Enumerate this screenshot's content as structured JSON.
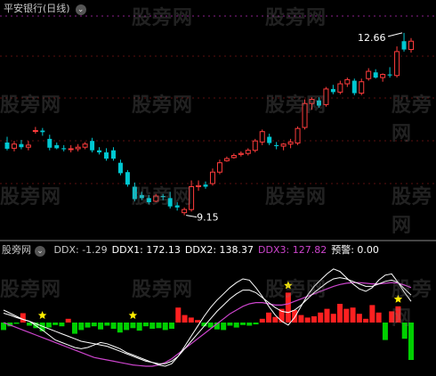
{
  "chart_title": "平安银行(日线)",
  "indicator_name": "股旁网",
  "watermark": "股旁网",
  "colors": {
    "up": "#ff3c3c",
    "down": "#00c8d2",
    "ddx_pos": "#ff2020",
    "ddx_neg": "#00d000",
    "ddx1": "#ffffff",
    "ddx2": "#ffffff",
    "ddx3": "#cc44cc",
    "star": "#ffee00",
    "grid": "#5a1010",
    "separator": "#888888",
    "title": "#c8c8c8",
    "label_value": "#ffffff"
  },
  "indicator_readout": [
    {
      "label": "DDX: ",
      "value": "-1.29",
      "color": "#c8c8c8"
    },
    {
      "label": "DDX1: ",
      "value": "172.13",
      "color": "#ffffff"
    },
    {
      "label": "DDX2: ",
      "value": "138.37",
      "color": "#ffffff"
    },
    {
      "label": "DDX3: ",
      "value": "127.82",
      "color": "#cc44cc"
    },
    {
      "label": "预警: ",
      "value": "0.00",
      "color": "#ffffff"
    }
  ],
  "chart_data": {
    "type": "candlestick",
    "price_high_label": "12.66",
    "price_low_label": "9.15",
    "price_range": [
      8.8,
      12.95
    ],
    "candles": [
      {
        "o": 10.55,
        "h": 10.66,
        "l": 10.4,
        "c": 10.43
      },
      {
        "o": 10.44,
        "h": 10.58,
        "l": 10.38,
        "c": 10.52
      },
      {
        "o": 10.52,
        "h": 10.6,
        "l": 10.42,
        "c": 10.46
      },
      {
        "o": 10.46,
        "h": 10.58,
        "l": 10.4,
        "c": 10.5
      },
      {
        "o": 10.78,
        "h": 10.85,
        "l": 10.72,
        "c": 10.78
      },
      {
        "o": 10.78,
        "h": 10.83,
        "l": 10.68,
        "c": 10.75
      },
      {
        "o": 10.62,
        "h": 10.7,
        "l": 10.4,
        "c": 10.45
      },
      {
        "o": 10.5,
        "h": 10.55,
        "l": 10.42,
        "c": 10.44
      },
      {
        "o": 10.44,
        "h": 10.5,
        "l": 10.38,
        "c": 10.42
      },
      {
        "o": 10.42,
        "h": 10.5,
        "l": 10.36,
        "c": 10.43
      },
      {
        "o": 10.43,
        "h": 10.52,
        "l": 10.38,
        "c": 10.46
      },
      {
        "o": 10.46,
        "h": 10.56,
        "l": 10.42,
        "c": 10.52
      },
      {
        "o": 10.58,
        "h": 10.64,
        "l": 10.36,
        "c": 10.4
      },
      {
        "o": 10.4,
        "h": 10.46,
        "l": 10.32,
        "c": 10.36
      },
      {
        "o": 10.36,
        "h": 10.44,
        "l": 10.2,
        "c": 10.24
      },
      {
        "o": 10.4,
        "h": 10.46,
        "l": 10.2,
        "c": 10.24
      },
      {
        "o": 10.16,
        "h": 10.22,
        "l": 9.92,
        "c": 9.96
      },
      {
        "o": 9.98,
        "h": 10.02,
        "l": 9.7,
        "c": 9.74
      },
      {
        "o": 9.7,
        "h": 9.78,
        "l": 9.42,
        "c": 9.46
      },
      {
        "o": 9.54,
        "h": 9.6,
        "l": 9.44,
        "c": 9.48
      },
      {
        "o": 9.48,
        "h": 9.54,
        "l": 9.36,
        "c": 9.4
      },
      {
        "o": 9.42,
        "h": 9.56,
        "l": 9.4,
        "c": 9.52
      },
      {
        "o": 9.52,
        "h": 9.56,
        "l": 9.44,
        "c": 9.5
      },
      {
        "o": 9.48,
        "h": 9.6,
        "l": 9.28,
        "c": 9.32
      },
      {
        "o": 9.34,
        "h": 9.4,
        "l": 9.24,
        "c": 9.3
      },
      {
        "o": 9.2,
        "h": 9.3,
        "l": 9.15,
        "c": 9.26
      },
      {
        "o": 9.26,
        "h": 9.82,
        "l": 9.22,
        "c": 9.7
      },
      {
        "o": 9.7,
        "h": 9.82,
        "l": 9.62,
        "c": 9.72
      },
      {
        "o": 9.74,
        "h": 9.8,
        "l": 9.66,
        "c": 9.7
      },
      {
        "o": 9.76,
        "h": 10.05,
        "l": 9.72,
        "c": 9.98
      },
      {
        "o": 9.98,
        "h": 10.22,
        "l": 9.94,
        "c": 10.16
      },
      {
        "o": 10.2,
        "h": 10.28,
        "l": 10.18,
        "c": 10.24
      },
      {
        "o": 10.26,
        "h": 10.34,
        "l": 10.24,
        "c": 10.3
      },
      {
        "o": 10.32,
        "h": 10.38,
        "l": 10.28,
        "c": 10.34
      },
      {
        "o": 10.34,
        "h": 10.44,
        "l": 10.3,
        "c": 10.4
      },
      {
        "o": 10.4,
        "h": 10.62,
        "l": 10.36,
        "c": 10.58
      },
      {
        "o": 10.56,
        "h": 10.8,
        "l": 10.5,
        "c": 10.76
      },
      {
        "o": 10.66,
        "h": 10.72,
        "l": 10.5,
        "c": 10.54
      },
      {
        "o": 10.5,
        "h": 10.56,
        "l": 10.42,
        "c": 10.48
      },
      {
        "o": 10.48,
        "h": 10.54,
        "l": 10.4,
        "c": 10.52
      },
      {
        "o": 10.52,
        "h": 10.62,
        "l": 10.44,
        "c": 10.56
      },
      {
        "o": 10.54,
        "h": 10.86,
        "l": 10.5,
        "c": 10.82
      },
      {
        "o": 10.84,
        "h": 11.38,
        "l": 10.8,
        "c": 11.3
      },
      {
        "o": 11.3,
        "h": 11.42,
        "l": 11.18,
        "c": 11.38
      },
      {
        "o": 11.36,
        "h": 11.42,
        "l": 11.22,
        "c": 11.26
      },
      {
        "o": 11.28,
        "h": 11.62,
        "l": 11.24,
        "c": 11.58
      },
      {
        "o": 11.58,
        "h": 11.66,
        "l": 11.48,
        "c": 11.52
      },
      {
        "o": 11.52,
        "h": 11.74,
        "l": 11.48,
        "c": 11.68
      },
      {
        "o": 11.68,
        "h": 11.8,
        "l": 11.62,
        "c": 11.76
      },
      {
        "o": 11.74,
        "h": 11.78,
        "l": 11.46,
        "c": 11.5
      },
      {
        "o": 11.5,
        "h": 11.78,
        "l": 11.46,
        "c": 11.72
      },
      {
        "o": 11.78,
        "h": 11.98,
        "l": 11.74,
        "c": 11.92
      },
      {
        "o": 11.9,
        "h": 11.96,
        "l": 11.78,
        "c": 11.8
      },
      {
        "o": 11.8,
        "h": 11.88,
        "l": 11.72,
        "c": 11.86
      },
      {
        "o": 11.86,
        "h": 12.0,
        "l": 11.8,
        "c": 11.84
      },
      {
        "o": 11.84,
        "h": 12.4,
        "l": 11.8,
        "c": 12.3
      },
      {
        "o": 12.5,
        "h": 12.66,
        "l": 12.3,
        "c": 12.34
      },
      {
        "o": 12.34,
        "h": 12.56,
        "l": 12.28,
        "c": 12.5
      }
    ],
    "ddx_range": [
      -8,
      10
    ],
    "ddx_bars": [
      -1.2,
      -0.6,
      -0.2,
      1.5,
      -0.5,
      -0.9,
      -1.4,
      -0.8,
      -0.4,
      -0.6,
      0.6,
      -1.8,
      -1.2,
      -0.8,
      -0.6,
      -1.1,
      -0.5,
      -1.0,
      -1.6,
      -1.2,
      -0.9,
      -1.3,
      -0.6,
      -1.0,
      -0.9,
      -1.2,
      -1.0,
      2.4,
      1.2,
      0.8,
      0.4,
      -0.6,
      -0.8,
      -1.1,
      -1.2,
      -0.5,
      -0.8,
      -0.4,
      -0.5,
      -0.3,
      0.6,
      1.6,
      0.9,
      2.2,
      4.8,
      2.0,
      1.2,
      0.8,
      1.0,
      1.6,
      2.2,
      1.4,
      3.0,
      2.2,
      2.4,
      1.4,
      0.6,
      2.8,
      1.6,
      -2.8,
      1.8,
      2.6,
      -2.6,
      -6.0
    ],
    "ddx1": [
      2,
      1.5,
      1,
      0.5,
      0.2,
      -0.5,
      -1.2,
      -2,
      -2.8,
      -3.2,
      -3.6,
      -4,
      -4.2,
      -4,
      -3.6,
      -3.2,
      -3.4,
      -3.8,
      -4.2,
      -4.8,
      -5.2,
      -5.6,
      -6,
      -6.4,
      -6.8,
      -7,
      -6.6,
      -5.4,
      -3.8,
      -2.2,
      -0.6,
      1,
      2.4,
      3.6,
      4.6,
      5.6,
      6.4,
      7,
      6.8,
      5.6,
      4.2,
      2.6,
      1.2,
      0.2,
      -0.4,
      0.8,
      2.6,
      4.4,
      5.8,
      6.8,
      7.8,
      8.6,
      8.2,
      7.2,
      6.2,
      5.4,
      5,
      5.6,
      6.8,
      7.6,
      7.8,
      6.4,
      4.8,
      3.4
    ],
    "ddx2": [
      1.5,
      1.2,
      0.8,
      0.5,
      0.2,
      -0.2,
      -0.6,
      -1,
      -1.4,
      -1.8,
      -2.2,
      -2.6,
      -3,
      -3.2,
      -3.4,
      -3.6,
      -3.8,
      -4.2,
      -4.6,
      -5,
      -5.4,
      -5.8,
      -6.2,
      -6.4,
      -6.6,
      -6.6,
      -6.2,
      -5.4,
      -4.2,
      -3,
      -1.8,
      -0.6,
      0.6,
      1.8,
      2.8,
      3.8,
      4.6,
      5.2,
      5.2,
      4.8,
      4,
      3.2,
      2.4,
      1.8,
      1.6,
      2,
      2.8,
      3.8,
      4.8,
      5.6,
      6.4,
      7,
      7.2,
      7,
      6.6,
      6.2,
      5.8,
      5.8,
      6.2,
      6.6,
      6.8,
      6.4,
      5.4,
      4.4
    ],
    "ddx3": [
      0,
      -0.4,
      -0.8,
      -1.2,
      -1.6,
      -2,
      -2.4,
      -2.8,
      -3.2,
      -3.6,
      -4,
      -4.4,
      -4.8,
      -5.2,
      -5.6,
      -5.8,
      -6,
      -6.2,
      -6.4,
      -6.6,
      -6.8,
      -6.9,
      -7,
      -7,
      -6.8,
      -6.4,
      -5.8,
      -5,
      -4.2,
      -3.4,
      -2.6,
      -1.8,
      -1,
      -0.2,
      0.6,
      1.4,
      2,
      2.6,
      3,
      3.2,
      3.2,
      3,
      2.8,
      2.8,
      3,
      3.4,
      3.8,
      4.2,
      4.6,
      5,
      5.4,
      5.8,
      6.1,
      6.3,
      6.4,
      6.4,
      6.3,
      6.2,
      6.2,
      6.3,
      6.4,
      6.3,
      6,
      5.6
    ],
    "star_positions": [
      6,
      20,
      44,
      61
    ]
  }
}
